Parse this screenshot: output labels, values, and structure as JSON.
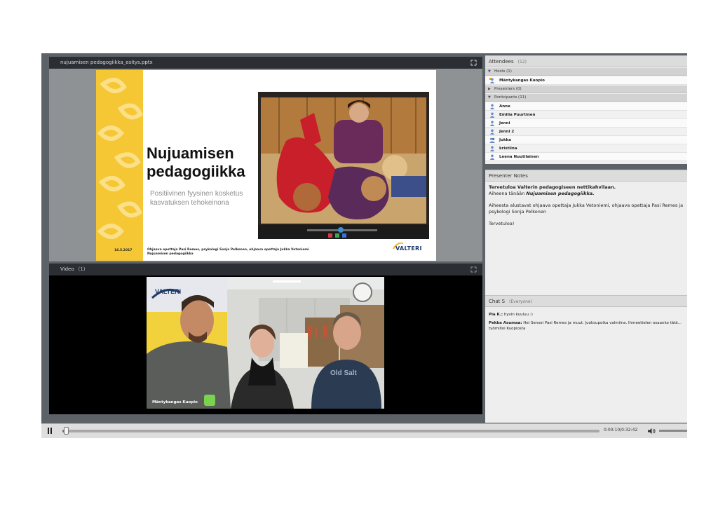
{
  "share_pod": {
    "title": "nujuamisen pedagogiikka_esitys.pptx",
    "slide": {
      "title": "Nujuamisen\npedagogiikka",
      "subtitle": "Positiivinen fyysinen kosketus\nkasvatuksen tehokeinona",
      "date": "16.5.2017",
      "footer": "Ohjaava opettaja Pasi Remes, psykologi Sonja Pelkonen, ohjaava opettaja Jukka Vetoniemi\nNujuamisen pedagogiikka",
      "logo": "VALTERI"
    }
  },
  "video_pod": {
    "title": "Video",
    "count": "(1)",
    "camera_label": "Mäntykangas Kuopio",
    "banner_text": "VALTERI"
  },
  "attendees": {
    "title": "Attendees",
    "count": "(12)",
    "sections": [
      {
        "label": "Hosts (1)",
        "expanded": true
      },
      {
        "label": "Presenters (0)",
        "expanded": false
      },
      {
        "label": "Participants (11)",
        "expanded": true
      }
    ],
    "hosts": [
      "Mäntykangas Kuopio"
    ],
    "participants": [
      "Anne",
      "Emilia Puurtinen",
      "Jenni",
      "Jenni 2",
      "Jukka",
      "kristiina",
      "Leena Nuutilainen"
    ]
  },
  "presenter_notes": {
    "title": "Presenter Notes",
    "line1": "Tervetuloa Valterin pedagogiseen nettikahvilaan.",
    "line2_prefix": "Aiheena tänään ",
    "line2_topic": "Nujuamisen pedagogiikka.",
    "line3": "Aiheesta alustavat ohjaava opettaja Jukka Vetoniemi, ohjaava opettaja Pasi Remes ja psykologi Sonja Pelkonen",
    "line4": "Tervetuloa!"
  },
  "chat": {
    "title": "Chat S",
    "scope": "(Everyone)",
    "messages": [
      {
        "author": "Pia K.:",
        "text": "hyvin kuuluu :)"
      },
      {
        "author": "Pekka Asumaa:",
        "text": "Hei Sensei Pasi Remes ja muut. Juoksupoika valmiina. Ihmeettelen osaanko tätä... työmilloi Kuopiosta"
      }
    ]
  },
  "player": {
    "time": "0:00:10/0:32:42",
    "progress": 0.005
  },
  "colors": {
    "slide_accent": "#f6c735",
    "pod_header": "#2b2e33",
    "app_background": "#5d6168"
  },
  "icons": [
    "expand-icon",
    "person-icon",
    "pause-icon",
    "volume-icon"
  ]
}
